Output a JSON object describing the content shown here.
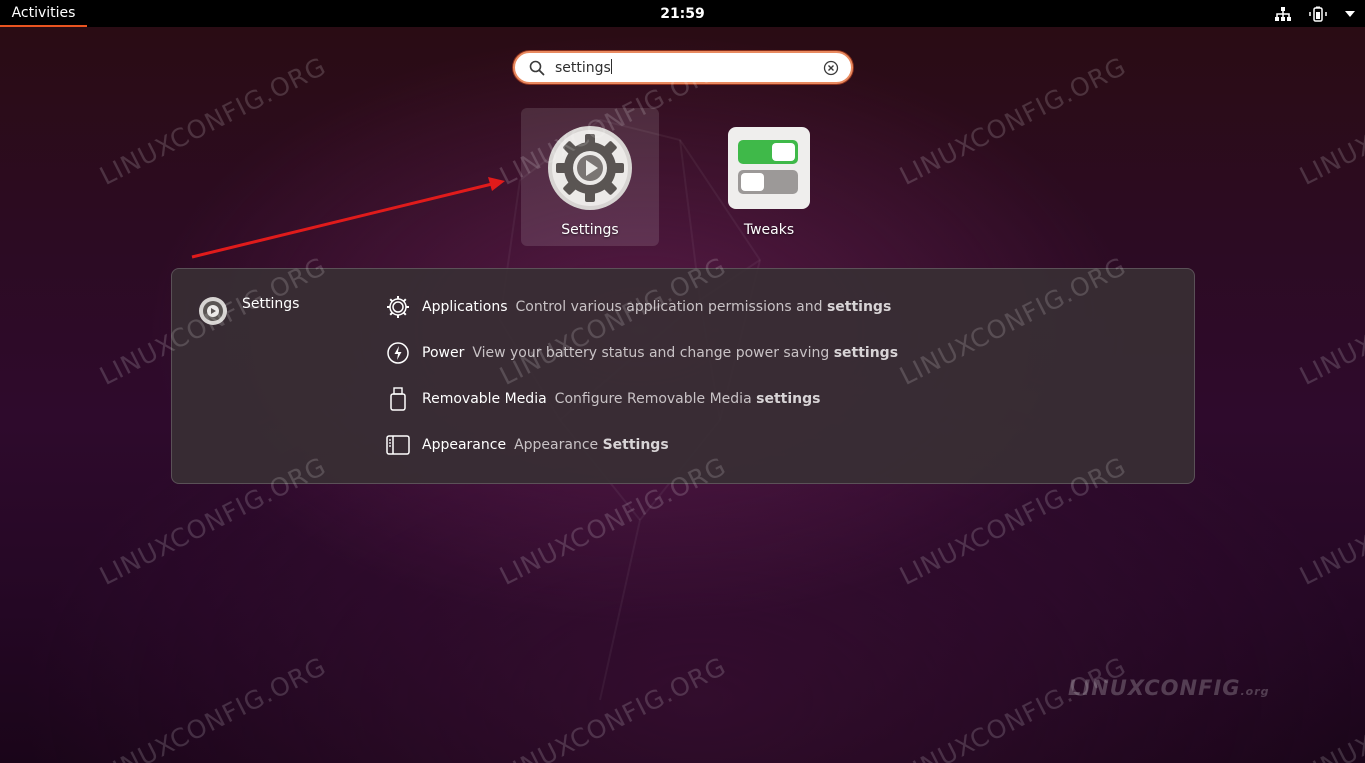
{
  "topbar": {
    "activities_label": "Activities",
    "clock": "21:59",
    "tray_icons": [
      "network-icon",
      "battery-icon",
      "menu-caret-icon"
    ]
  },
  "search": {
    "value": "settings",
    "icons": [
      "search-icon",
      "clear-icon"
    ]
  },
  "apps": [
    {
      "label": "Settings",
      "icon": "settings-gear-icon",
      "selected": true
    },
    {
      "label": "Tweaks",
      "icon": "tweaks-toggle-icon",
      "selected": false
    }
  ],
  "results": {
    "provider_label": "Settings",
    "items": [
      {
        "name": "Applications",
        "desc": "Control various application permissions and",
        "highlight": "settings",
        "icon": "applications-gear-icon"
      },
      {
        "name": "Power",
        "desc": "View your battery status and change power saving",
        "highlight": "settings",
        "icon": "power-icon"
      },
      {
        "name": "Removable Media",
        "desc": "Configure Removable Media",
        "highlight": "settings",
        "icon": "usb-drive-icon"
      },
      {
        "name": "Appearance",
        "desc": "Appearance",
        "highlight": "Settings",
        "icon": "appearance-icon"
      }
    ]
  },
  "watermark": {
    "text": "LINUXCONFIG.ORG",
    "logo_main": "LINUXCONFIG",
    "logo_suffix": ".org"
  },
  "colors": {
    "accent": "#e95420",
    "toggle_on": "#3fb949",
    "panel_bg": "#382e34"
  }
}
